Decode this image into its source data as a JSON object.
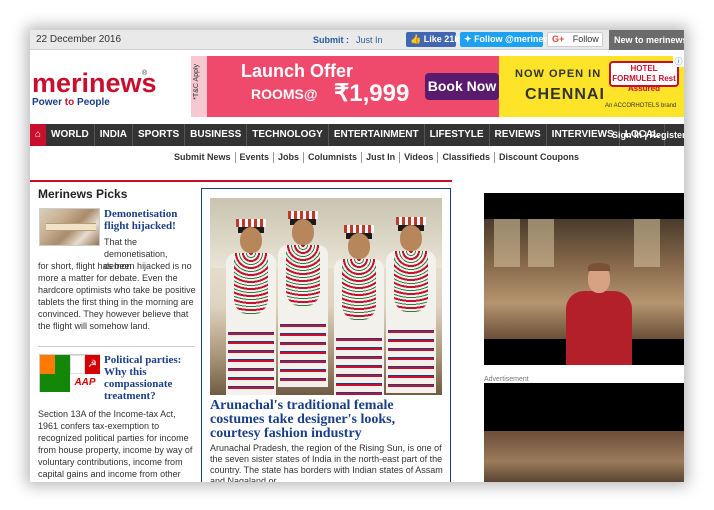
{
  "topbar": {
    "date": "22 December 2016",
    "submit_label": "Submit :",
    "just_in_label": "Just In",
    "fb_like": "Like 21k",
    "twitter_follow": "Follow @merinews",
    "google_follow": "Follow",
    "google_g": "G+",
    "new_to": "New to merinews?"
  },
  "logo": {
    "name": "merinews",
    "tagline_a": "Power",
    "tagline_to": "to",
    "tagline_b": "People"
  },
  "ad_banner": {
    "tc": "*T&C Apply",
    "headline": "Launch Offer",
    "rooms": "ROOMS@",
    "price": "₹1,999",
    "cta": "Book Now",
    "now_open": "NOW OPEN IN",
    "city": "CHENNAI",
    "hotel": "HOTEL FORMULE1 Rest Assured",
    "accor": "An ACCORHOTELS brand"
  },
  "nav": {
    "items": [
      "WORLD",
      "INDIA",
      "SPORTS",
      "BUSINESS",
      "TECHNOLOGY",
      "ENTERTAINMENT",
      "LIFESTYLE",
      "REVIEWS",
      "INTERVIEWS",
      "LOCAL"
    ],
    "sign_in": "Sign In | Register"
  },
  "subnav": {
    "items": [
      "Submit News",
      "Events",
      "Jobs",
      "Columnists",
      "Just In",
      "Videos",
      "Classifieds",
      "Discount Coupons"
    ]
  },
  "picks": {
    "title": "Merinews Picks",
    "items": [
      {
        "headline": "Demonetisation flight hijacked!",
        "body_top": "That the demonetisation, demon",
        "body": "for short, flight has been hijacked is no more a matter for debate. Even the hardcore optimists who take be positive tablets the first thing in the morning are convinced. They however believe that the flight will somehow land."
      },
      {
        "headline": "Political parties: Why this compassionate treatment?",
        "body": "Section 13A of the Income-tax Act, 1961 confers tax-exemption to recognized political parties for income from house property, income by way of voluntary contributions, income from capital gains and income from other sources. In other"
      }
    ]
  },
  "feature": {
    "title": "Arunachal's traditional female costumes take designer's looks, courtesy fashion industry",
    "body": "Arunachal Pradesh, the region of the Rising Sun, is one of the seven sister states of India in the north-east part of the country. The state has borders with Indian states of Assam and Nagaland or"
  },
  "sidebar": {
    "advertisement_label": "Advertisement"
  },
  "colors": {
    "brand_red": "#c8102e",
    "brand_blue": "#1a3f87",
    "nav_bg": "#333333"
  }
}
